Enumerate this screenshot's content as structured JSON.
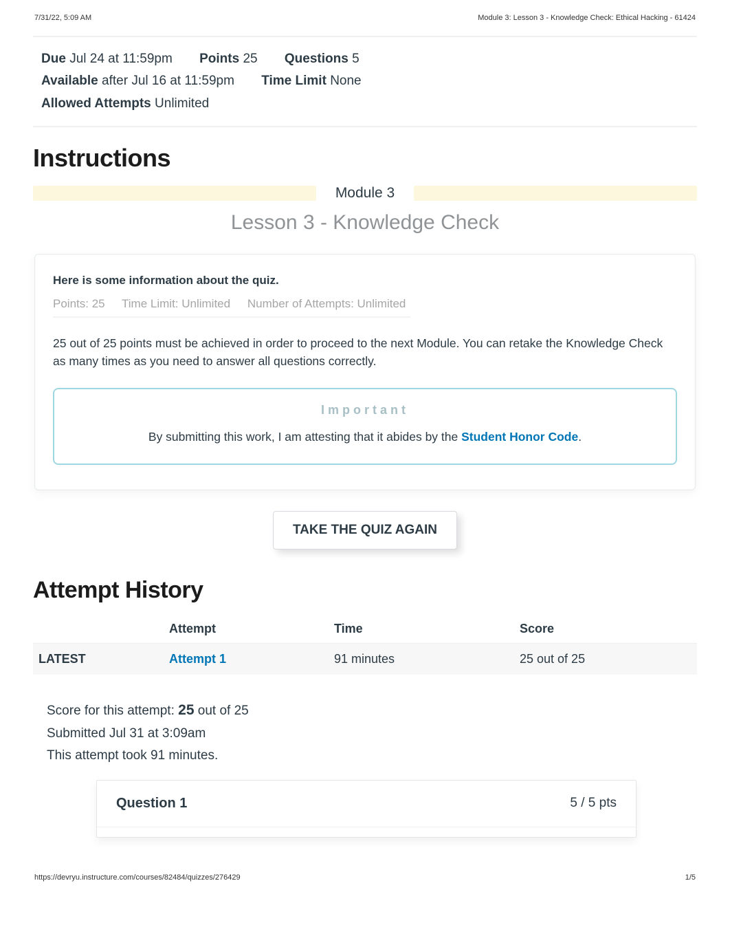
{
  "print": {
    "timestamp": "7/31/22, 5:09 AM",
    "doc_title": "Module 3: Lesson 3 - Knowledge Check: Ethical Hacking - 61424",
    "url": "https://devryu.instructure.com/courses/82484/quizzes/276429",
    "page_indicator": "1/5"
  },
  "meta": {
    "due_label": "Due",
    "due_value": "Jul 24 at 11:59pm",
    "points_label": "Points",
    "points_value": "25",
    "questions_label": "Questions",
    "questions_value": "5",
    "available_label": "Available",
    "available_value": "after Jul 16 at 11:59pm",
    "timelimit_label": "Time Limit",
    "timelimit_value": "None",
    "attempts_label": "Allowed Attempts",
    "attempts_value": "Unlimited"
  },
  "headings": {
    "instructions": "Instructions",
    "attempt_history": "Attempt History"
  },
  "banner": {
    "module": "Module 3",
    "lesson": "Lesson 3 - Knowledge Check"
  },
  "info_card": {
    "lead": "Here is some information about the quiz.",
    "points": "Points: 25",
    "timelimit": "Time Limit: Unlimited",
    "attempts": "Number of Attempts: Unlimited",
    "body": "25 out of 25 points must be achieved in order to proceed to the next Module. You can retake the Knowledge Check as many times as you need to answer all questions correctly.",
    "important_title": "Important",
    "important_prefix": "By submitting this work, I am attesting that it abides by the ",
    "honor_link": "Student Honor Code",
    "important_suffix": "."
  },
  "actions": {
    "take_again": "TAKE THE QUIZ AGAIN"
  },
  "history": {
    "headers": {
      "attempt": "Attempt",
      "time": "Time",
      "score": "Score"
    },
    "rows": [
      {
        "status": "LATEST",
        "attempt": "Attempt 1",
        "time": "91 minutes",
        "score": "25 out of 25"
      }
    ]
  },
  "score_block": {
    "line1_prefix": "Score for this attempt: ",
    "line1_big": "25",
    "line1_suffix": " out of 25",
    "line2": "Submitted Jul 31 at 3:09am",
    "line3": "This attempt took 91 minutes."
  },
  "question": {
    "title": "Question 1",
    "pts": "5 / 5 pts"
  }
}
